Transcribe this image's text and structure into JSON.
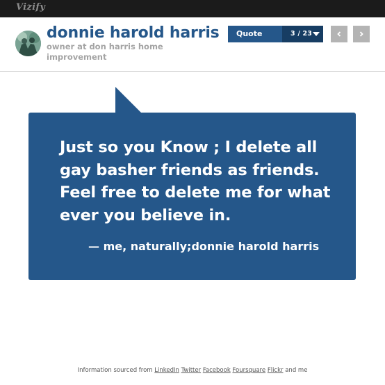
{
  "topbar": {
    "logo": "Vizify"
  },
  "profile": {
    "name": "donnie harold harris",
    "subtitle": "owner at don harris home improvement"
  },
  "quote_nav": {
    "label": "Quote",
    "counter": "3 / 23"
  },
  "quote": {
    "text": "Just so you Know ; I delete all gay basher friends as friends. Feel free to delete me for what ever you believe in.",
    "attribution": "— me, naturally;donnie harold harris"
  },
  "footer": {
    "prefix": "Information sourced from",
    "links": [
      "LinkedIn",
      "Twitter",
      "Facebook",
      "Foursquare",
      "Flickr"
    ],
    "suffix": "and me"
  },
  "colors": {
    "topbar": "#1b1b1b",
    "accent": "#25578a",
    "accent_dark": "#173d63",
    "nav_button": "#b4b4b4",
    "subtitle": "#a4a4a4"
  },
  "icons": {
    "prev": "chevron-left-icon",
    "next": "chevron-right-icon",
    "dropdown": "caret-down-icon"
  }
}
